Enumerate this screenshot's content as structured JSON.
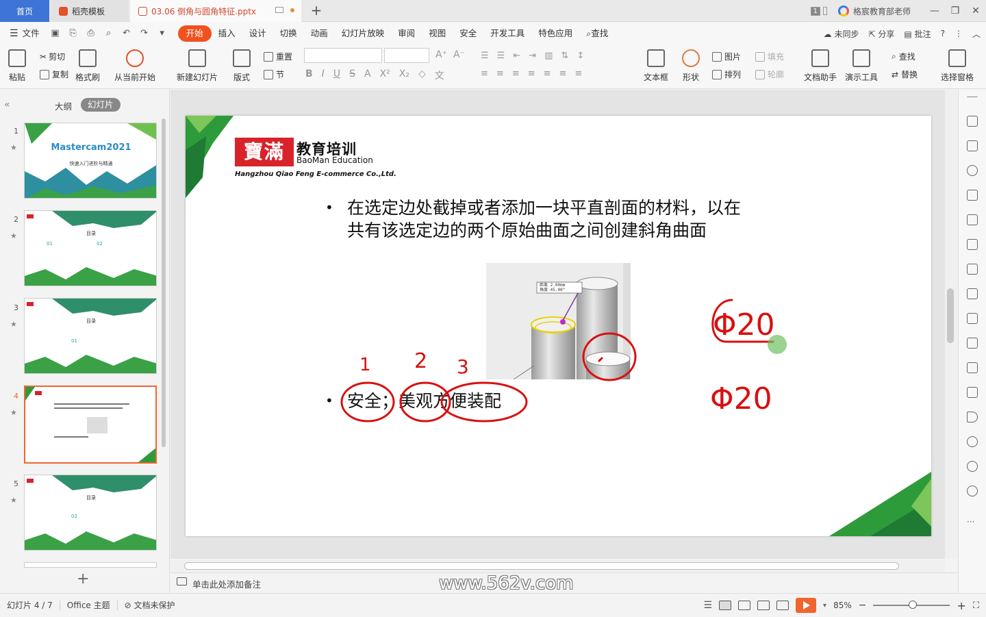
{
  "tabs": {
    "home": "首页",
    "template": "稻壳模板",
    "document": "03.06 倒角与圆角特征.pptx"
  },
  "titlebar": {
    "window_count": "1",
    "user": "格宸教育部老师"
  },
  "menu": {
    "file": "文件",
    "items": [
      "开始",
      "插入",
      "设计",
      "切换",
      "动画",
      "幻灯片放映",
      "审阅",
      "视图",
      "安全",
      "开发工具",
      "特色应用"
    ],
    "search": "查找",
    "sync": "未同步",
    "share": "分享",
    "comment": "批注"
  },
  "ribbon": {
    "paste": "粘贴",
    "cut": "剪切",
    "copy": "复制",
    "format_painter": "格式刷",
    "play_from_current": "从当前开始",
    "new_slide": "新建幻灯片",
    "layout": "版式",
    "reset": "重置",
    "section": "节",
    "textbox": "文本框",
    "shape": "形状",
    "picture": "图片",
    "arrange": "排列",
    "fill": "填充",
    "outline": "轮廓",
    "doc_assistant": "文档助手",
    "present_tool": "演示工具",
    "find": "查找",
    "replace": "替换",
    "select_pane": "选择窗格"
  },
  "left_panel": {
    "tab_outline": "大纲",
    "tab_slides": "幻灯片",
    "slide_numbers": [
      "1",
      "2",
      "3",
      "4",
      "5"
    ],
    "thumb1_title": "Mastercam2021",
    "thumb1_subtitle": "快速入门进阶与精通",
    "thumb_toc": "目录",
    "thumb2_items": [
      "01",
      "02"
    ],
    "thumb3_item": "01",
    "thumb5_item": "02"
  },
  "slide": {
    "logo_cn_mark": "寶滿",
    "logo_cn": "教育培训",
    "logo_en": "BaoMan Education",
    "company": "Hangzhou Qiao Feng E-commerce Co.,Ltd.",
    "bullet1_line1": "在选定边处截掉或者添加一块平直剖面的材料，以在",
    "bullet1_line2": "共有该选定边的两个原始曲面之间创建斜角曲面",
    "bullet2": "安全；美观方便装配",
    "cad_dist_label": "距离",
    "cad_dist_value": "2.00mm",
    "cad_angle_label": "角度",
    "cad_angle_value": "45.00°",
    "annotations": {
      "n1": "1",
      "n2": "2",
      "n3": "3",
      "phi1": "Φ20",
      "phi2": "Φ20"
    }
  },
  "notes_placeholder": "单击此处添加备注",
  "watermark": "www.562v.com",
  "status": {
    "slide_pos": "幻灯片 4 / 7",
    "theme": "Office 主题",
    "protect": "文档未保护",
    "zoom": "85%"
  },
  "colors": {
    "accent": "#f0521f",
    "home_tab": "#3d74d6",
    "ink_red": "#d81010",
    "logo_red": "#d8232a",
    "slide_green": "#2e9b3a"
  }
}
